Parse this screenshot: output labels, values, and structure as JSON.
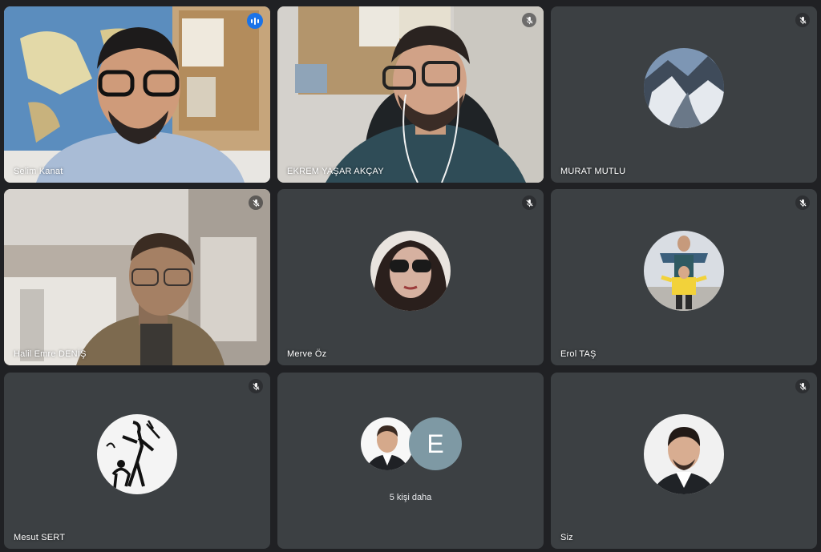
{
  "participants": [
    {
      "name": "Selim Kanat",
      "speaking": true
    },
    {
      "name": "EKREM YAŞAR AKÇAY",
      "muted": true
    },
    {
      "name": "MURAT MUTLU",
      "muted": true
    },
    {
      "name": "Halil Emre DENİŞ",
      "muted": true
    },
    {
      "name": "Merve Öz",
      "muted": true
    },
    {
      "name": "Erol TAŞ",
      "muted": true
    },
    {
      "name": "Mesut SERT",
      "muted": true
    },
    {
      "name": "",
      "more_label": "5 kişi daha",
      "initial": "E"
    },
    {
      "name": "Siz",
      "muted": true
    }
  ],
  "icons": {
    "muted": "mic-off-icon",
    "speaking": "audio-level-icon"
  },
  "colors": {
    "background": "#202124",
    "tile": "#3c4043",
    "active_outline": "#8ab4f8",
    "speaking_indicator": "#1a73e8"
  }
}
